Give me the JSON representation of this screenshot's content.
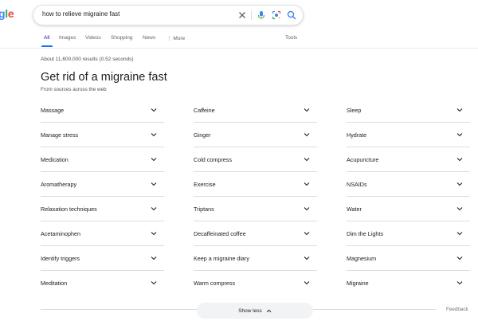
{
  "logo": {
    "part1": "g",
    "part2": "l",
    "part3": "e"
  },
  "search": {
    "query": "how to relieve migraine fast"
  },
  "nav": {
    "tabs": [
      {
        "label": "All"
      },
      {
        "label": "Images"
      },
      {
        "label": "Videos"
      },
      {
        "label": "Shopping"
      },
      {
        "label": "News"
      },
      {
        "label": "More"
      }
    ],
    "tools": "Tools"
  },
  "results": {
    "stats": "About 11,600,000 results (0.52 seconds)"
  },
  "panel": {
    "title": "Get rid of a migraine fast",
    "subtitle": "From sources across the web",
    "columns": [
      [
        "Massage",
        "Manage stress",
        "Medication",
        "Aromatherapy",
        "Relaxation techniques",
        "Acetaminophen",
        "Identify triggers",
        "Meditation"
      ],
      [
        "Caffeine",
        "Ginger",
        "Cold compress",
        "Exercise",
        "Triptans",
        "Decaffeinated coffee",
        "Keep a migraine diary",
        "Warm compress"
      ],
      [
        "Sleep",
        "Hydrate",
        "Acupuncture",
        "NSAIDs",
        "Water",
        "Dim the Lights",
        "Magnesium",
        "Migraine"
      ]
    ],
    "show_less": "Show less"
  },
  "footer": {
    "feedback": "Feedback"
  },
  "colors": {
    "accent": "#1a73e8",
    "link": "#1a0dab",
    "divider": "#dadce0"
  }
}
